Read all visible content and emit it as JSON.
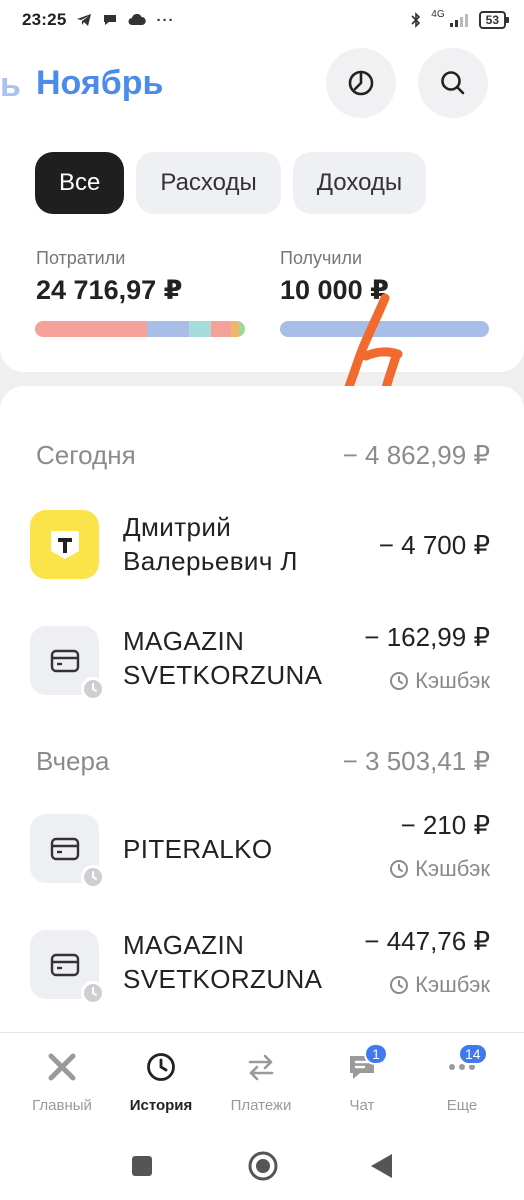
{
  "status_bar": {
    "time": "23:25",
    "icons": [
      "telegram-icon",
      "chat-icon",
      "cloud-icon",
      "more-dots-icon"
    ],
    "network": "4G",
    "battery": "53"
  },
  "header": {
    "prev_month_fragment": "ь",
    "month": "Ноябрь"
  },
  "filters": [
    {
      "label": "Все",
      "active": true
    },
    {
      "label": "Расходы",
      "active": false
    },
    {
      "label": "Доходы",
      "active": false
    }
  ],
  "summary": {
    "spent_label": "Потратили",
    "spent_value": "24 716,97 ₽",
    "received_label": "Получили",
    "received_value": "10 000 ₽",
    "spent_bar_colors": [
      "#f4a19a",
      "#a9bde9",
      "#a7dcdc",
      "#f4a19a",
      "#f2b56b",
      "#9fd79a"
    ],
    "received_bar_color": "#a9bde9"
  },
  "sections": [
    {
      "title": "Сегодня",
      "total": "− 4 862,99 ₽",
      "operations": [
        {
          "title_line1": "Дмитрий",
          "title_line2": "Валерьевич Л",
          "amount": "− 4 700 ₽",
          "icon": "bank-logo-icon"
        },
        {
          "title_line1": "MAGAZIN",
          "title_line2": "SVETKORZUNA",
          "amount": "− 162,99 ₽",
          "cashback": "Кэшбэк",
          "icon": "card-icon"
        }
      ]
    },
    {
      "title": "Вчера",
      "total": "− 3 503,41 ₽",
      "operations": [
        {
          "title_line1": "PITERALKO",
          "amount": "− 210 ₽",
          "cashback": "Кэшбэк",
          "icon": "card-icon"
        },
        {
          "title_line1": "MAGAZIN",
          "title_line2": "SVETKORZUNA",
          "amount": "− 447,76 ₽",
          "cashback": "Кэшбэк",
          "icon": "card-icon"
        }
      ]
    }
  ],
  "bottom_nav": [
    {
      "label": "Главный",
      "icon": "main-icon",
      "active": false
    },
    {
      "label": "История",
      "icon": "history-clock-icon",
      "active": true
    },
    {
      "label": "Платежи",
      "icon": "transfer-arrows-icon",
      "active": false
    },
    {
      "label": "Чат",
      "icon": "chat-bubble-icon",
      "active": false,
      "badge": "1"
    },
    {
      "label": "Еще",
      "icon": "more-dots-icon",
      "active": false,
      "badge": "14"
    }
  ],
  "colors": {
    "accent": "#4b8bec",
    "badge": "#3f78f0",
    "chip_active": "#1f1f1f",
    "scribble": "#f26a2e",
    "bank_yellow": "#fbe34a"
  }
}
